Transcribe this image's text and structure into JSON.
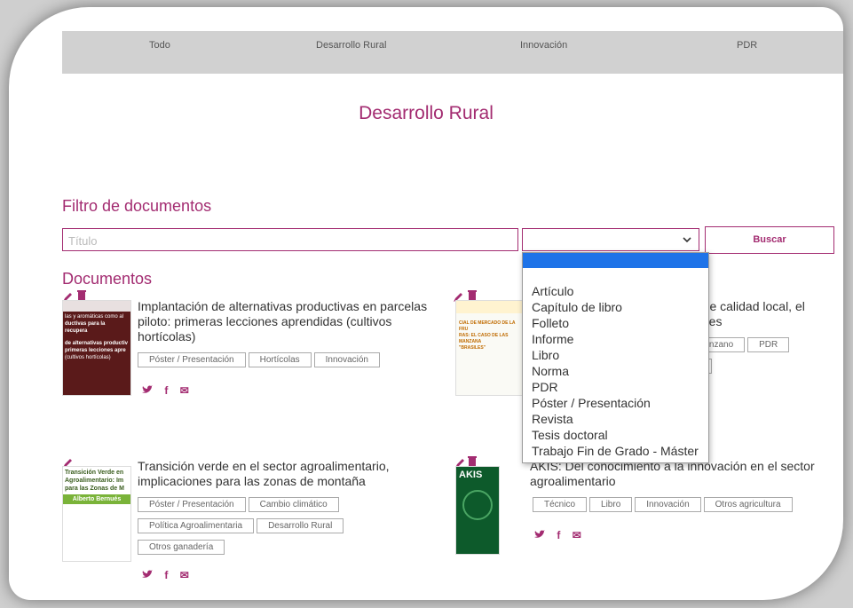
{
  "nav": {
    "tabs": [
      {
        "label": "Todo"
      },
      {
        "label": "Desarrollo Rural"
      },
      {
        "label": "Innovación"
      },
      {
        "label": "PDR"
      }
    ]
  },
  "page_title": "Desarrollo Rural",
  "filter": {
    "heading": "Filtro de documentos",
    "title_placeholder": "Título",
    "search_label": "Buscar"
  },
  "dropdown": {
    "options": [
      "",
      "Artículo",
      "Capítulo de libro",
      "Folleto",
      "Informe",
      "Libro",
      "Norma",
      "PDR",
      "Póster / Presentación",
      "Revista",
      "Tesis doctoral",
      "Trabajo Fin de Grado - Máster"
    ]
  },
  "documents": {
    "heading": "Documentos",
    "items": [
      {
        "title": "Implantación de alternativas productivas en parcelas piloto: primeras lecciones aprendidas (cultivos hortícolas)",
        "tags": [
          "Póster / Presentación",
          "Hortícolas",
          "Innovación"
        ],
        "thumb_lines": [
          "las y aromáticas como al",
          "ductivas para la recupera",
          "de alternativas productiv",
          "primeras lecciones apre",
          "(cultivos hortícolas)"
        ]
      },
      {
        "title_line1": "a de calidad local, el",
        "title_line2": "ubles",
        "tags": [
          "Manzano",
          "PDR",
          "o"
        ],
        "thumb_lines": [
          "CIAL DE MERCADO DE LA FRU",
          "RAS: EL CASO DE LAS MANZANA",
          "\"BRASILES\""
        ]
      },
      {
        "title": "Transición verde en el sector agroalimentario, implicaciones para las zonas de montaña",
        "tags": [
          "Póster / Presentación",
          "Cambio climático",
          "Política Agroalimentaria",
          "Desarrollo Rural",
          "Otros ganadería"
        ],
        "thumb_lines": [
          "Transición Verde en",
          "Agroalimentario: Im",
          "para las Zonas de M",
          "Alberto Bernués"
        ]
      },
      {
        "title_partial": "AKIS: Del conocimiento a la innovación en el sector agroalimentario",
        "tags": [
          "Técnico",
          "Libro",
          "Innovación",
          "Otros agricultura"
        ],
        "thumb_lines": [
          "AKIS"
        ]
      }
    ]
  },
  "social": {
    "twitter": "t",
    "facebook": "f",
    "email": "✉"
  },
  "colors": {
    "accent": "#a32c71",
    "nav_bg": "#d1d1d1",
    "select_highlight": "#1e73e8"
  }
}
